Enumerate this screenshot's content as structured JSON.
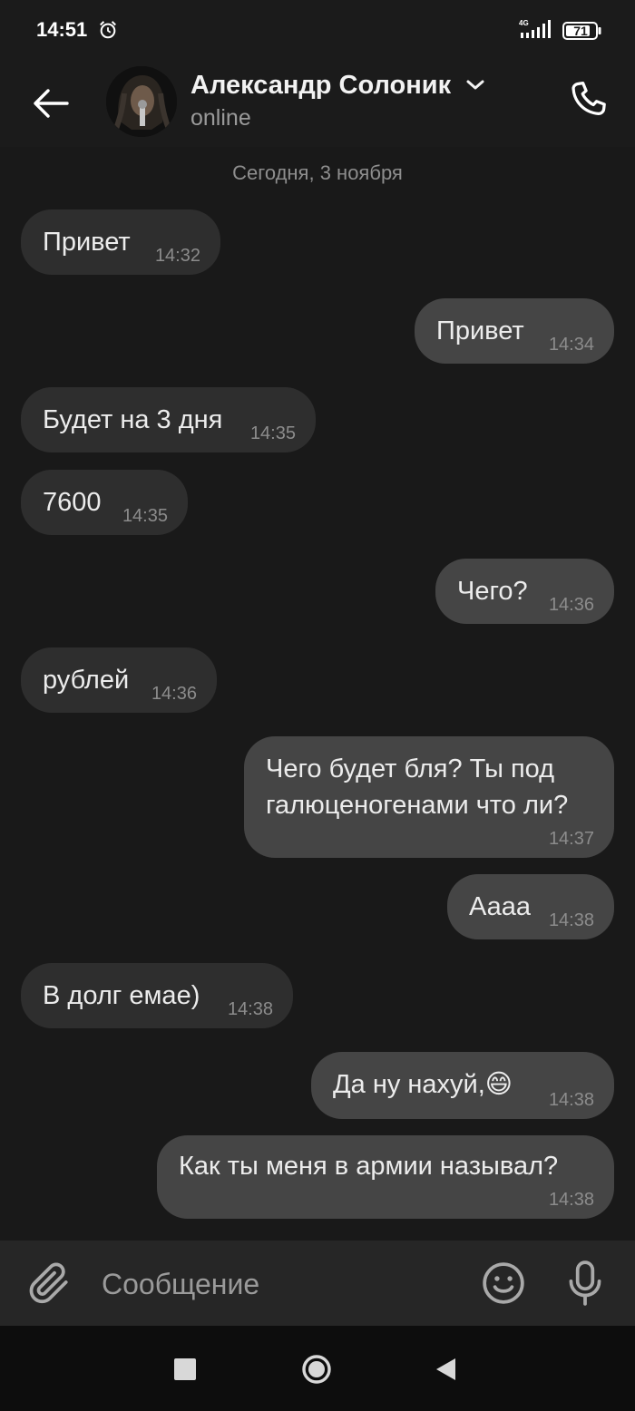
{
  "status_bar": {
    "time": "14:51",
    "network": "4G",
    "battery": "71"
  },
  "header": {
    "contact_name": "Александр Солоник",
    "status": "online"
  },
  "chat": {
    "date_separator": "Сегодня, 3 ноября",
    "messages": [
      {
        "direction": "in",
        "text": "Привет",
        "time": "14:32"
      },
      {
        "direction": "out",
        "text": "Привет",
        "time": "14:34"
      },
      {
        "direction": "in",
        "text": "Будет на 3 дня",
        "time": "14:35"
      },
      {
        "direction": "in",
        "text": "7600",
        "time": "14:35"
      },
      {
        "direction": "out",
        "text": "Чего?",
        "time": "14:36"
      },
      {
        "direction": "in",
        "text": "рублей",
        "time": "14:36"
      },
      {
        "direction": "out",
        "text": "Чего будет бля? Ты под галюценогенами что ли?",
        "time": "14:37"
      },
      {
        "direction": "out",
        "text": "Аааа",
        "time": "14:38"
      },
      {
        "direction": "in",
        "text": "В долг емае)",
        "time": "14:38"
      },
      {
        "direction": "out",
        "text": "Да ну нахуй,😄",
        "time": "14:38"
      },
      {
        "direction": "out",
        "text": "Как ты меня в армии называл?",
        "time": "14:38"
      }
    ]
  },
  "composer": {
    "placeholder": "Сообщение"
  },
  "colors": {
    "background": "#191919",
    "incoming_bubble": "#2e2e2e",
    "outgoing_bubble": "#454545",
    "timestamp": "#8c8c8c"
  }
}
